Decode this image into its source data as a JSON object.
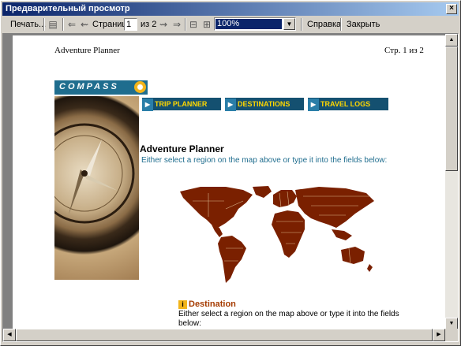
{
  "window": {
    "title": "Предварительный просмотр"
  },
  "toolbar": {
    "print_label": "Печать...",
    "page_label": "Страница",
    "page_value": "1",
    "page_total": "из 2",
    "zoom_value": "100%",
    "help_label": "Справка",
    "close_label": "Закрыть"
  },
  "page": {
    "header_left": "Adventure Planner",
    "header_right": "Стр. 1 из 2",
    "logo_text": "COMPASS",
    "nav": [
      "TRIP PLANNER",
      "DESTINATIONS",
      "TRAVEL LOGS"
    ],
    "title": "Adventure Planner",
    "subtitle": "Either select a region on the map above or type it into the fields below:",
    "destination_title": "Destination",
    "destination_text": "Either select a region on the map above or type it into the fields below:"
  },
  "colors": {
    "map": "#7a2000",
    "nav_bg": "#145070",
    "nav_text": "#ffd700",
    "accent": "#1f6d8e"
  },
  "icons": [
    "print-preview-icon",
    "prev-page-icon",
    "next-page-icon",
    "help-icon",
    "close-icon",
    "compass-sun-icon",
    "info-icon"
  ]
}
